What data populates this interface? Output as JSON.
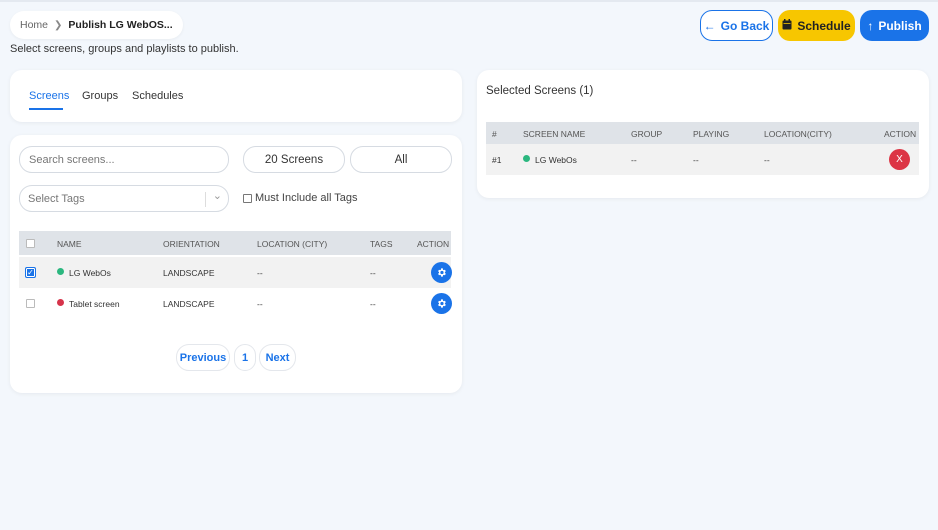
{
  "breadcrumb": {
    "home": "Home",
    "current": "Publish LG WebOS..."
  },
  "subtitle": "Select screens, groups and playlists to publish.",
  "actions": {
    "go_back": "Go Back",
    "schedule": "Schedule",
    "publish": "Publish"
  },
  "tabs": [
    {
      "label": "Screens",
      "active": true
    },
    {
      "label": "Groups",
      "active": false
    },
    {
      "label": "Schedules",
      "active": false
    }
  ],
  "filters": {
    "search_placeholder": "Search screens...",
    "screen_count": "20 Screens",
    "all_label": "All",
    "tags_placeholder": "Select Tags",
    "must_include_label": "Must Include all Tags"
  },
  "screens_table": {
    "headers": {
      "name": "NAME",
      "orientation": "ORIENTATION",
      "location": "LOCATION (CITY)",
      "tags": "TAGS",
      "action": "ACTION"
    },
    "rows": [
      {
        "name": "LG WebOs",
        "status_color": "#2bb77f",
        "orientation": "LANDSCAPE",
        "location": "--",
        "tags": "--",
        "checked": true
      },
      {
        "name": "Tablet screen",
        "status_color": "#d6334a",
        "orientation": "LANDSCAPE",
        "location": "--",
        "tags": "--",
        "checked": false
      }
    ]
  },
  "pagination": {
    "previous": "Previous",
    "page": "1",
    "next": "Next"
  },
  "selected": {
    "title": "Selected Screens (1)",
    "headers": {
      "index": "#",
      "screen_name": "SCREEN NAME",
      "group": "GROUP",
      "playing": "PLAYING",
      "location": "LOCATION(CITY)",
      "action": "ACTION"
    },
    "rows": [
      {
        "index": "#1",
        "screen_name": "LG WebOs",
        "status_color": "#2bb77f",
        "group": "--",
        "playing": "--",
        "location": "--",
        "remove": "X"
      }
    ]
  },
  "colors": {
    "primary": "#1a73e8",
    "schedule": "#f7c600",
    "danger": "#dc3545",
    "online": "#2bb77f",
    "offline": "#d6334a"
  }
}
